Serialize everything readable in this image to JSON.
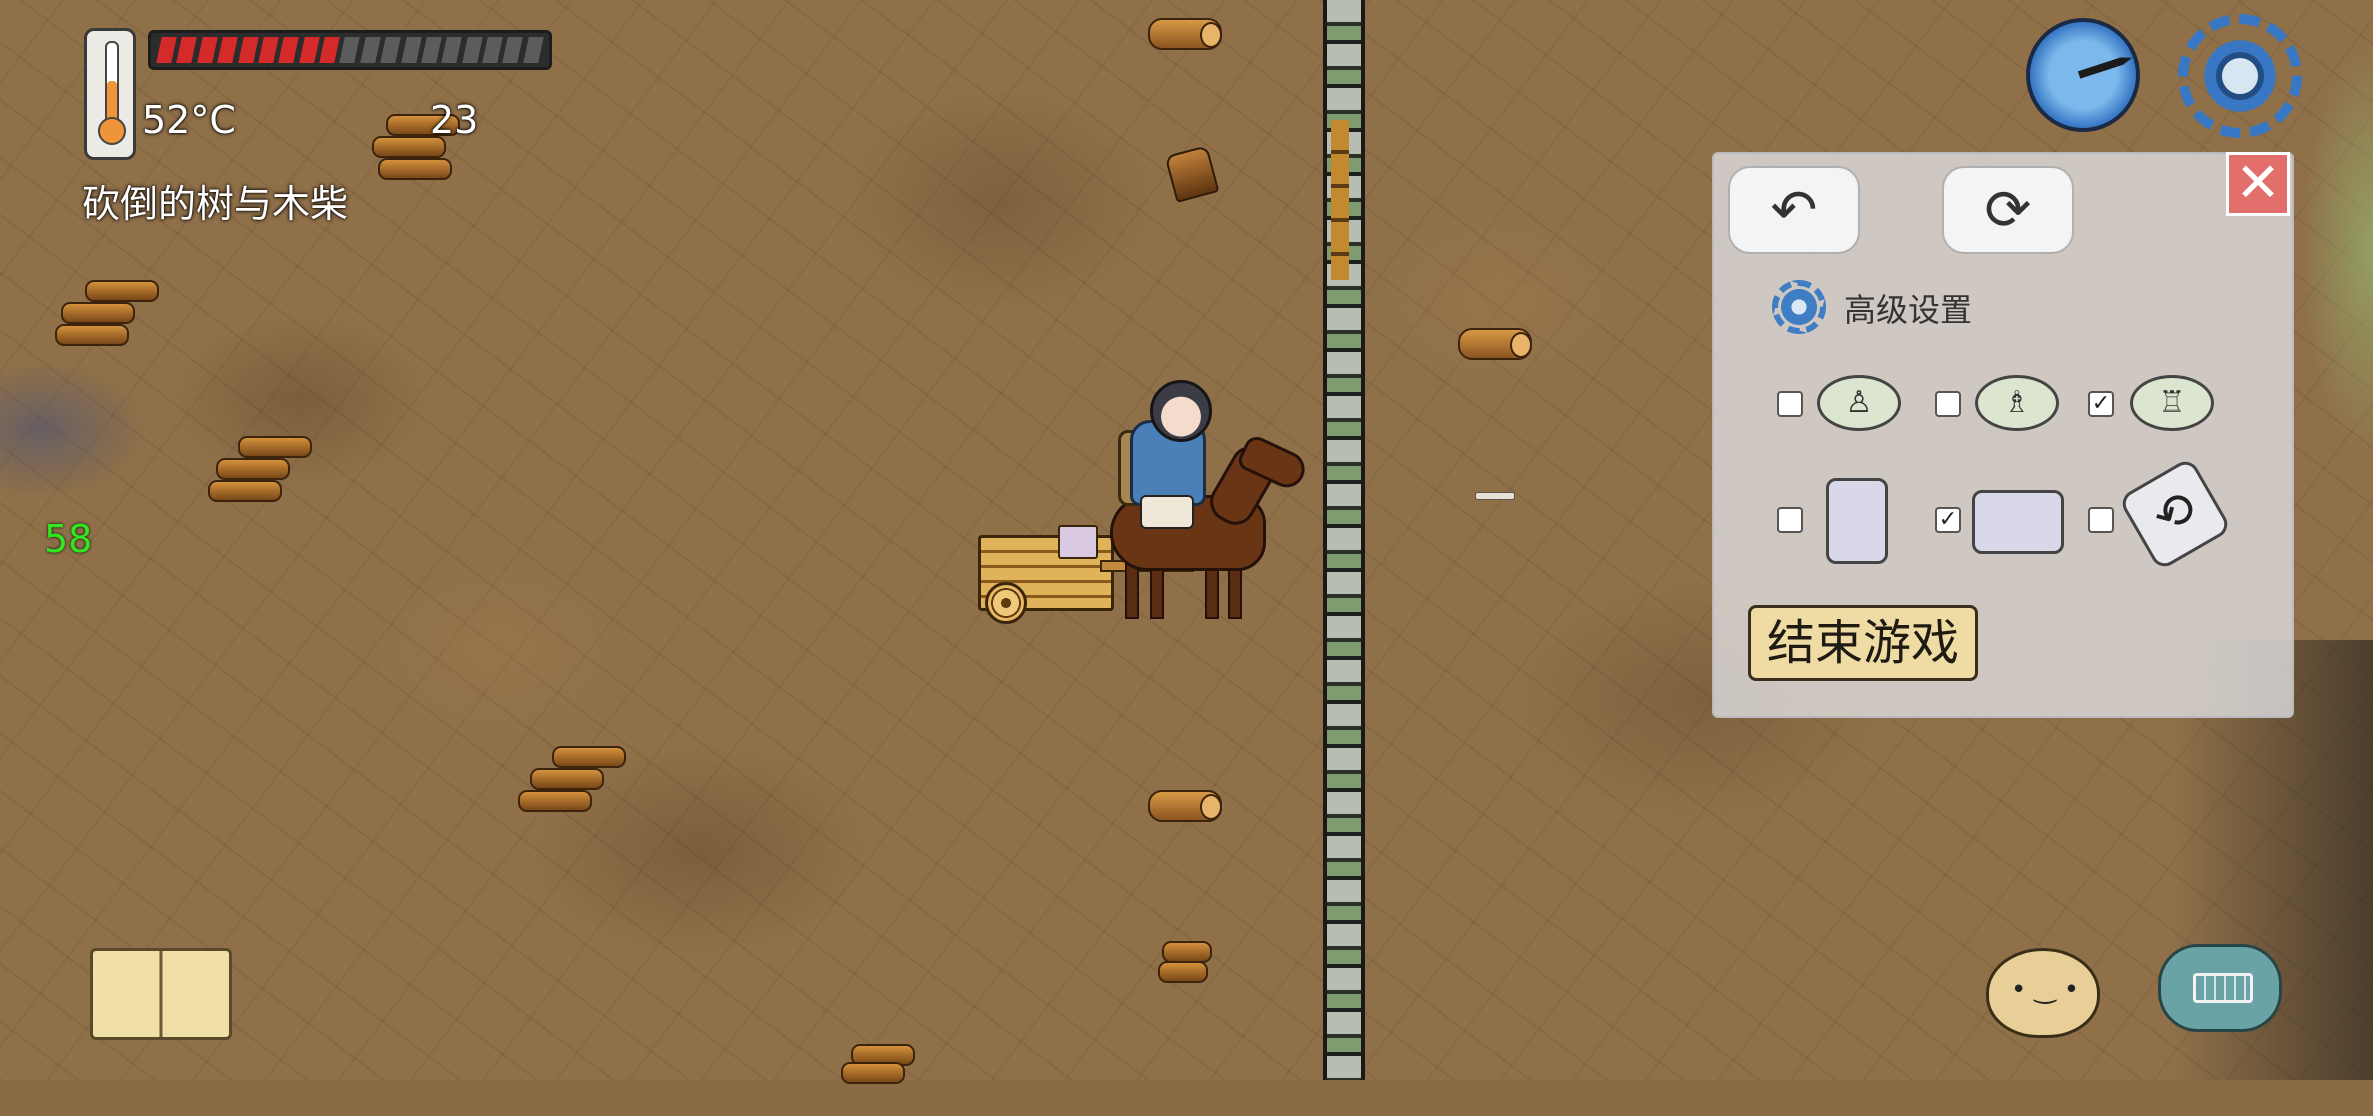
{
  "hud": {
    "temperature": "52°C",
    "age": "23",
    "object_label": "砍倒的树与木柴",
    "fps": "58",
    "health_segments_total": 19,
    "health_segments_filled": 9
  },
  "settings_panel": {
    "close_label": "✕",
    "advanced_label": "高级设置",
    "end_game_label": "结束游戏",
    "view_options": [
      {
        "checked": false,
        "icon": "eye-view-small-icon"
      },
      {
        "checked": false,
        "icon": "eye-view-medium-icon"
      },
      {
        "checked": true,
        "icon": "eye-view-large-icon"
      }
    ],
    "device_options": [
      {
        "checked": false,
        "icon": "phone-portrait-icon"
      },
      {
        "checked": true,
        "icon": "tablet-landscape-icon"
      },
      {
        "checked": false,
        "icon": "auto-rotate-icon"
      }
    ]
  },
  "colors": {
    "health_fill": "#d42a2a",
    "fps_text": "#2fe81f",
    "accent_blue": "#3777c4"
  }
}
